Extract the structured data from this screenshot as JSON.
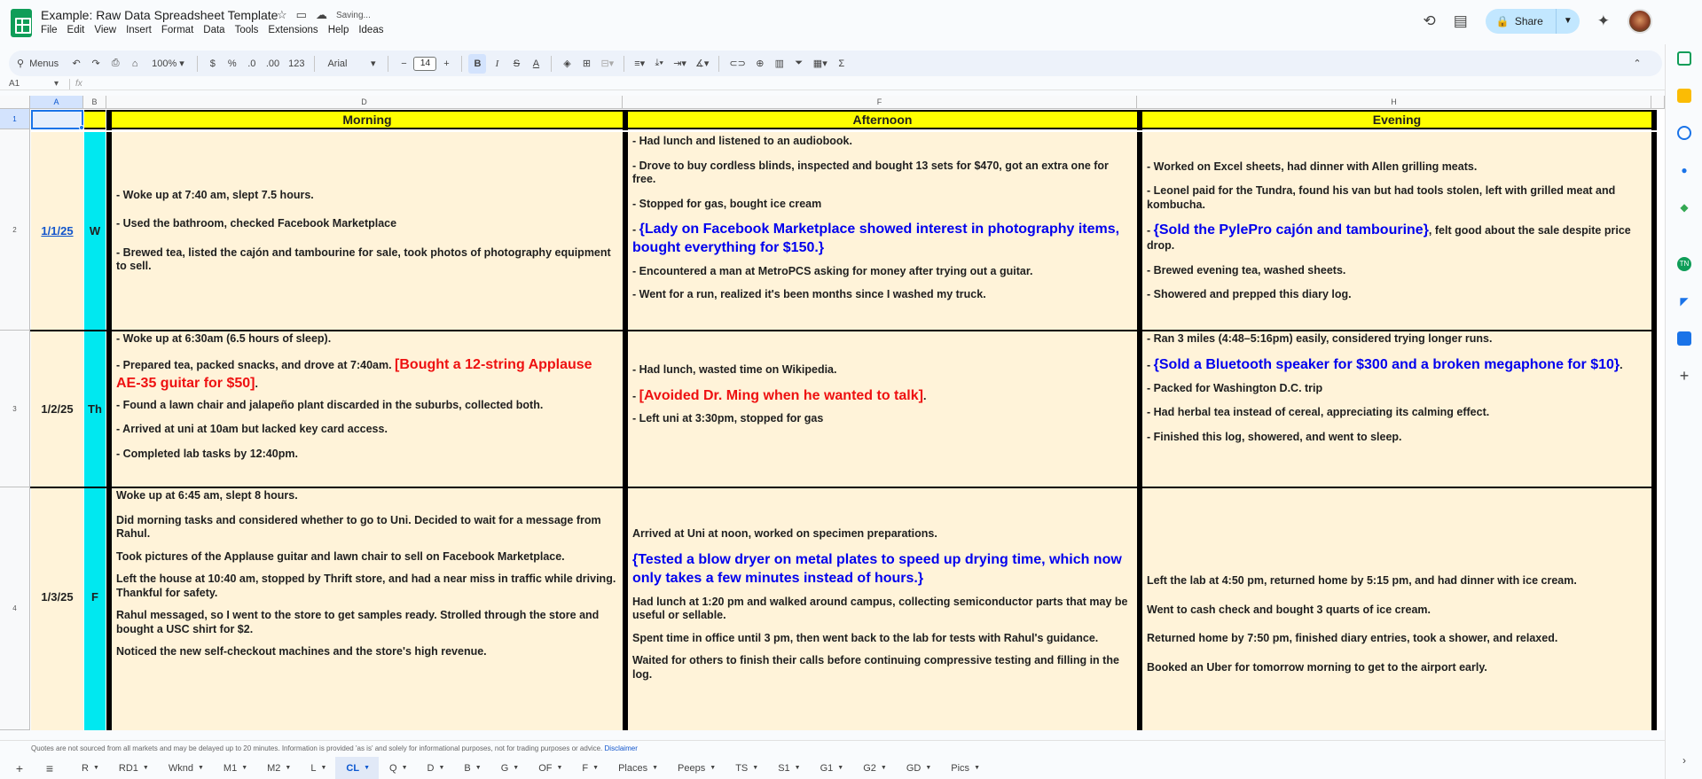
{
  "doc": {
    "title": "Example: Raw Data Spreadsheet Template",
    "saving": "Saving..."
  },
  "menu": [
    "File",
    "Edit",
    "View",
    "Insert",
    "Format",
    "Data",
    "Tools",
    "Extensions",
    "Help",
    "Ideas"
  ],
  "share_label": "Share",
  "toolbar": {
    "menus": "Menus",
    "zoom": "100%",
    "currency": "$",
    "percent": "%",
    "dec_less": ".0",
    "dec_more": ".00",
    "number_format": "123",
    "font": "Arial",
    "font_size": "14",
    "bold": "B",
    "italic": "I"
  },
  "namebox": "A1",
  "fx": "fx",
  "columns": [
    "A",
    "B",
    "D",
    "F",
    "H"
  ],
  "rows": [
    "1",
    "2",
    "3",
    "4"
  ],
  "headers": {
    "morning": "Morning",
    "afternoon": "Afternoon",
    "evening": "Evening"
  },
  "entries": [
    {
      "date": "1/1/25",
      "day": "W",
      "morning": [
        "- Woke up at 7:40 am, slept 7.5 hours.",
        "- Used the bathroom, checked Facebook Marketplace",
        "- Brewed tea, listed the cajón and tambourine for sale, took photos of photography equipment to sell."
      ],
      "afternoon": [
        "- Had lunch and listened to an audiobook.",
        "- Drove to buy cordless blinds, inspected and bought 13 sets for $470, got an extra one for free.",
        "- Stopped for gas, bought ice cream",
        "{Lady on Facebook Marketplace showed interest in photography items, bought everything for $150.}",
        "- Encountered a man at MetroPCS asking for money after trying out a guitar.",
        "- Went for a run, realized it's been months since I washed my truck."
      ],
      "evening": [
        "- Worked on Excel sheets, had dinner with Allen grilling meats.",
        "- Leonel paid for the Tundra, found his van but had tools stolen, left with grilled meat and kombucha.",
        "{Sold the PylePro cajón and tambourine}",
        ", felt good about the sale despite price drop.",
        "- Brewed evening tea, washed sheets.",
        "- Showered and prepped this diary log."
      ]
    },
    {
      "date": "1/2/25",
      "day": "Th",
      "morning": [
        "- Woke up at 6:30am (6.5 hours of sleep).",
        "- Prepared tea, packed snacks, and drove at 7:40am.",
        "[Bought a 12-string Applause AE-35 guitar for $50]",
        "- Found a lawn chair and jalapeño plant discarded in the suburbs, collected both.",
        "- Arrived at uni at 10am but lacked key card access.",
        "- Completed lab tasks by 12:40pm."
      ],
      "afternoon": [
        "- Had lunch, wasted time on Wikipedia.",
        "[Avoided Dr. Ming when he wanted to talk]",
        "- Left uni at 3:30pm, stopped for gas"
      ],
      "evening": [
        "- Ran 3 miles (4:48–5:16pm) easily, considered trying longer runs.",
        "{Sold a Bluetooth speaker for $300 and a broken megaphone for $10}",
        "- Packed for Washington D.C. trip",
        "- Had herbal tea instead of cereal, appreciating its calming effect.",
        "- Finished this log, showered, and went to sleep."
      ]
    },
    {
      "date": "1/3/25",
      "day": "F",
      "morning": [
        "Woke up at 6:45 am, slept 8 hours.",
        "Did morning tasks and considered whether to go to Uni. Decided to wait for a message from Rahul.",
        "Took pictures of the Applause guitar and lawn chair to sell on Facebook Marketplace.",
        "Left the house at 10:40 am, stopped by Thrift store, and had a near miss in traffic while driving. Thankful for safety.",
        "Rahul messaged, so I went to the store to get samples ready. Strolled through the store and bought a USC shirt for $2.",
        "Noticed the new self-checkout machines and the store's high revenue."
      ],
      "afternoon": [
        "Arrived at Uni at noon, worked on specimen preparations.",
        "{Tested a blow dryer on metal plates to speed up drying time, which now only takes a few minutes instead of hours.}",
        "Had lunch at 1:20 pm and walked around campus, collecting semiconductor parts that may be useful or sellable.",
        "Spent time in office until 3 pm, then went back to the lab for tests with Rahul's guidance.",
        "Waited for others to finish their calls before continuing compressive testing and filling in the log."
      ],
      "evening": [
        "Left the lab at 4:50 pm, returned home by 5:15 pm, and had dinner with ice cream.",
        "Went to cash check and bought 3 quarts of ice cream.",
        "Returned home by 7:50 pm, finished diary entries, took a shower, and relaxed.",
        "Booked an Uber for tomorrow morning to get to the airport early."
      ]
    }
  ],
  "notice": {
    "text": "Quotes are not sourced from all markets and may be delayed up to 20 minutes. Information is provided 'as is' and solely for informational purposes, not for trading purposes or advice.",
    "link": "Disclaimer"
  },
  "sheets": [
    "R",
    "RD1",
    "Wknd",
    "M1",
    "M2",
    "L",
    "CL",
    "Q",
    "D",
    "B",
    "G",
    "OF",
    "F",
    "Places",
    "Peeps",
    "TS",
    "S1",
    "G1",
    "G2",
    "GD",
    "Pics"
  ],
  "active_sheet": "CL",
  "colors": {
    "header_yellow": "#ffff00",
    "day_cyan": "#00e8f0",
    "cell_cream": "#fff3d9",
    "highlight_blue": "#0000ee",
    "highlight_red": "#ee1111",
    "share_bg": "#c2e7ff"
  }
}
